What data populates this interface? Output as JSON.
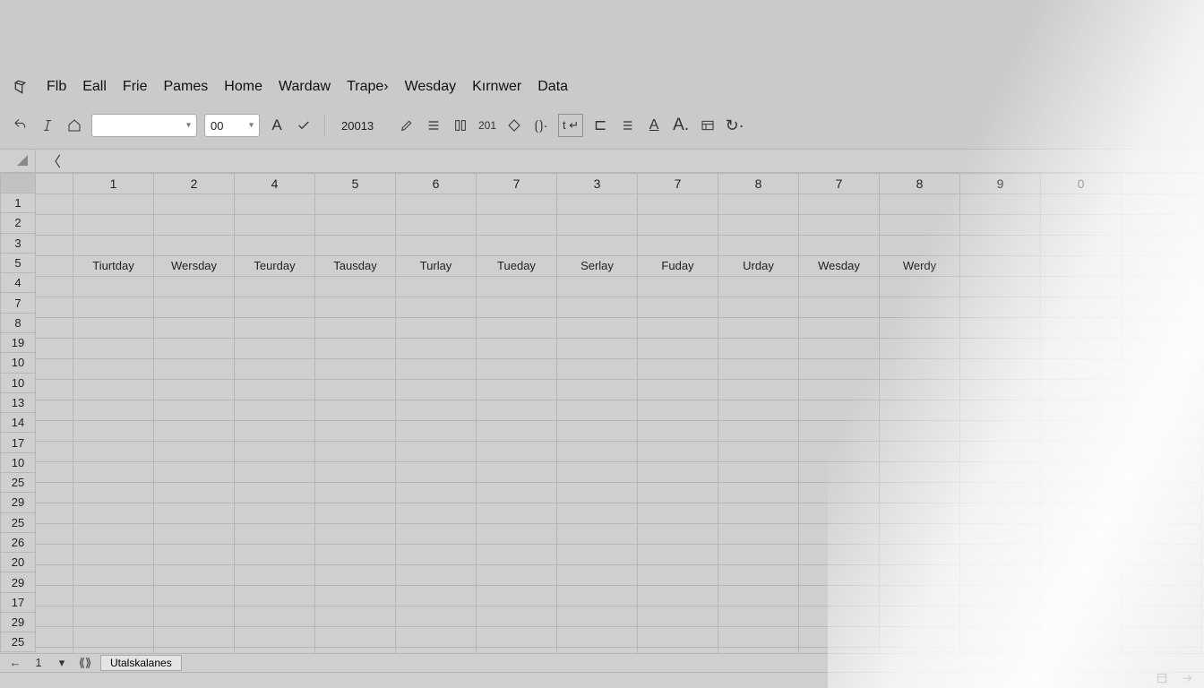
{
  "menu": {
    "items": [
      "Flb",
      "Eall",
      "Frie",
      "Pames",
      "Home",
      "Wardaw",
      "Trape›",
      "Wesday",
      "Kırnwer",
      "Data"
    ]
  },
  "toolbar": {
    "font_name": "",
    "font_size": "00",
    "number_box": "20013",
    "secondary_num": "201"
  },
  "column_headers_first": "",
  "column_headers": [
    "1",
    "2",
    "4",
    "5",
    "6",
    "7",
    "3",
    "7",
    "8",
    "7",
    "8",
    "9",
    "0",
    ""
  ],
  "row_labels": [
    "1",
    "2",
    "3",
    "5",
    "4",
    "7",
    "8",
    "19",
    "10",
    "10",
    "13",
    "14",
    "17",
    "10",
    "25",
    "29",
    "25",
    "26",
    "20",
    "29",
    "17",
    "29",
    "25"
  ],
  "day_row": [
    "",
    "Tiurtday",
    "Wersday",
    "Teurday",
    "Tausday",
    "Turlay",
    "Tueday",
    "Serlay",
    "Fuday",
    "Urday",
    "Wesday",
    "Werdy",
    "",
    "",
    ""
  ],
  "sheet": {
    "active_tab": "Utalskalanes",
    "page_indicator": "1"
  }
}
